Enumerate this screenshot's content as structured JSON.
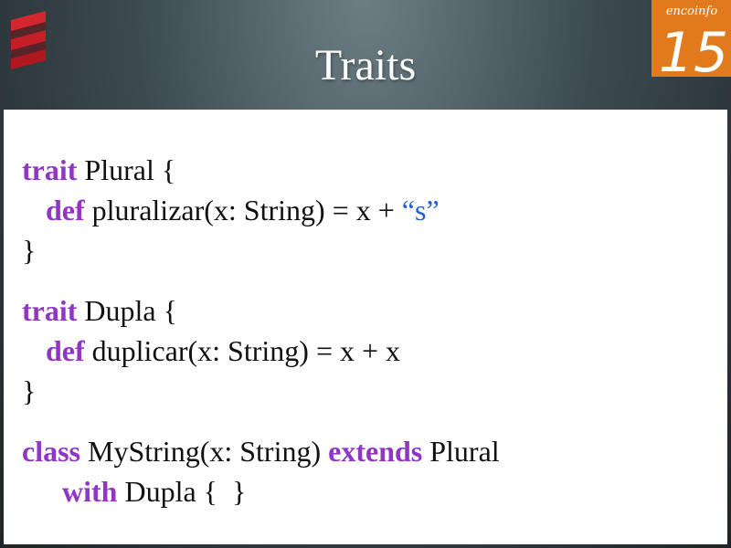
{
  "slide": {
    "title": "Traits",
    "logo_left_icon": "scala-logo-icon",
    "logo_right": {
      "icon": "encoinfo-logo-icon",
      "text": "encoinfo",
      "number": "15",
      "color": "#e07a1c"
    }
  },
  "code": {
    "keyword_color": "#9135c4",
    "string_color": "#1f5fd1",
    "t1": {
      "kw": "trait",
      "rest": " Plural {"
    },
    "t2": {
      "kw": "def",
      "rest": " pluralizar(x: String) = x + ",
      "str": "“s”"
    },
    "t3": {
      "rest": "}"
    },
    "t4": {
      "kw": "trait",
      "rest": " Dupla {"
    },
    "t5": {
      "kw": "def",
      "rest": " duplicar(x: String) = x + x"
    },
    "t6": {
      "rest": "}"
    },
    "t7": {
      "kw1": "class",
      "mid": " MyString(x: String) ",
      "kw2": "extends",
      "rest": " Plural"
    },
    "t8": {
      "kw": "with",
      "rest": " Dupla {  }"
    }
  }
}
